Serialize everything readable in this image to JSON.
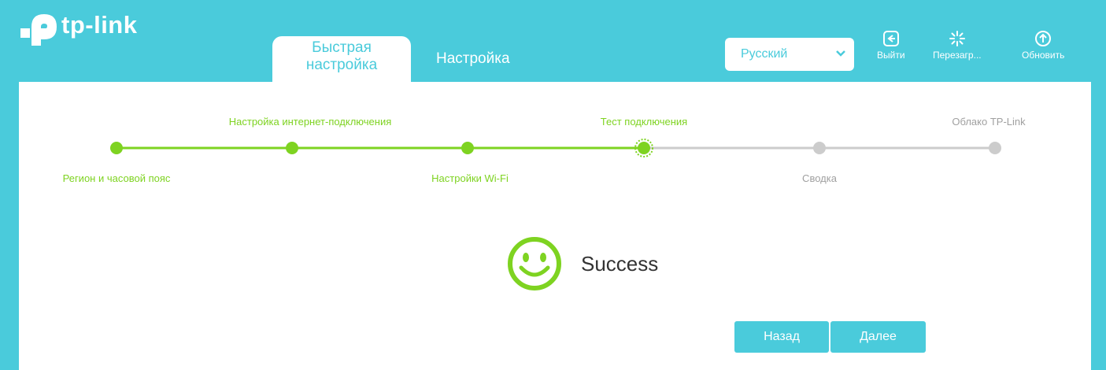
{
  "brand": {
    "logo_text": "tp-link",
    "accent": "#4acbdb",
    "progress_done": "#7ed321",
    "progress_todo": "#cccccc"
  },
  "tabs": [
    {
      "label_line1": "Быстрая",
      "label_line2": "настройка",
      "active": true
    },
    {
      "label": "Настройка",
      "active": false
    }
  ],
  "language_select": {
    "selected": "Русский"
  },
  "toolbar": {
    "logout": "Выйти",
    "reboot": "Перезагр...",
    "update": "Обновить"
  },
  "wizard": {
    "steps": [
      {
        "label": "Регион и часовой пояс",
        "status": "done"
      },
      {
        "label": "Настройка интернет-подключения",
        "status": "done"
      },
      {
        "label": "Настройки Wi-Fi",
        "status": "done"
      },
      {
        "label": "Тест подключения",
        "status": "current"
      },
      {
        "label": "Сводка",
        "status": "todo"
      },
      {
        "label": "Облако TP-Link",
        "status": "todo"
      }
    ]
  },
  "result": {
    "icon": "smiley-icon",
    "text": "Success"
  },
  "buttons": {
    "back": "Назад",
    "next": "Далее"
  }
}
